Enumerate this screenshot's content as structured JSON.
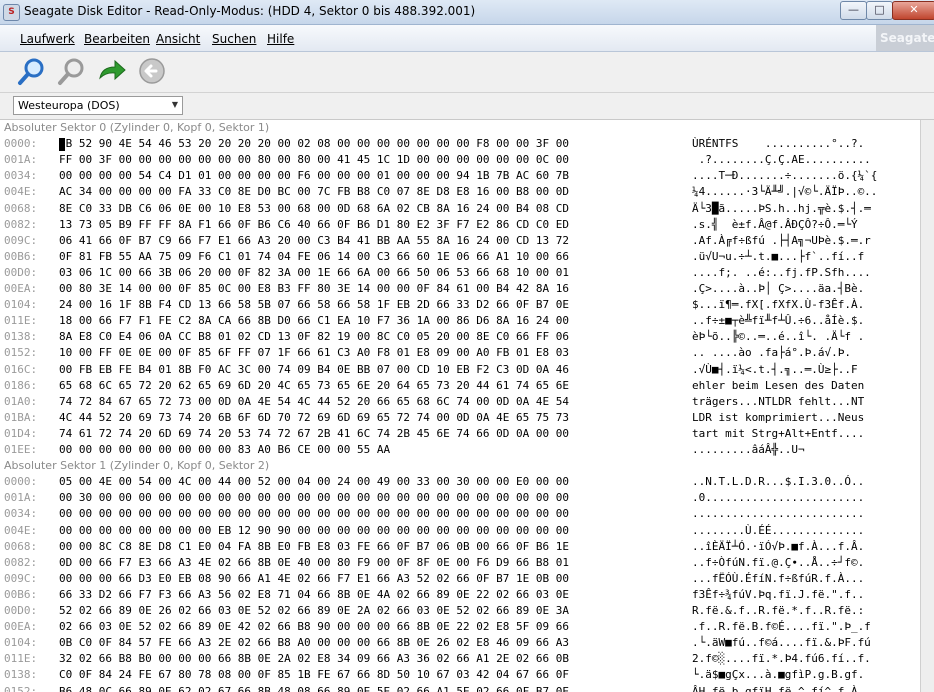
{
  "window": {
    "title": "Seagate Disk Editor - Read-Only-Modus: (HDD 4, Sektor 0 bis 488.392.001)",
    "app_icon_letter": "S",
    "controls": {
      "minimize": "—",
      "maximize": "□",
      "close": "✕"
    }
  },
  "menu": {
    "items": [
      "Laufwerk",
      "Bearbeiten",
      "Ansicht",
      "Suchen",
      "Hilfe"
    ],
    "brand": "Seagate"
  },
  "toolbar": {
    "icons": [
      "search-icon",
      "search-next-icon",
      "forward-arrow-icon",
      "back-arrow-icon"
    ],
    "colors": {
      "forward": "#2e9a2e",
      "back_disabled": "#9a9a9a",
      "magnifier": "#2a6fc4"
    }
  },
  "encoding": {
    "selected": "Westeuropa (DOS)"
  },
  "sectors": [
    {
      "header": "Absoluter Sektor 0 (Zylinder 0, Kopf 0, Sektor 1)",
      "rows": [
        {
          "addr": "0000:",
          "hex": "EB 52 90 4E 54 46 53 20 20 20 20 00 02 08 00 00 00 00 00 00 00 F8 00 00 3F 00",
          "ascii": "ÙRÉNTFS    ..........°..?."
        },
        {
          "addr": "001A:",
          "hex": "FF 00 3F 00 00 00 00 00 00 00 80 00 80 00 41 45 1C 1D 00 00 00 00 00 00 0C 00",
          "ascii": " .?........Ç.Ç.AE.........."
        },
        {
          "addr": "0034:",
          "hex": "00 00 00 00 54 C4 D1 01 00 00 00 00 F6 00 00 00 01 00 00 00 94 1B 7B AC 60 7B",
          "ascii": "....T─Ð.......÷.......ö.{¼`{"
        },
        {
          "addr": "004E:",
          "hex": "AC 34 00 00 00 00 FA 33 C0 8E D0 BC 00 7C FB B8 C0 07 8E D8 E8 16 00 B8 00 0D",
          "ascii": "¼4......·3└Ä╨╝.|√©└.ÄÏÞ..©.."
        },
        {
          "addr": "0068:",
          "hex": "8E C0 33 DB C6 06 0E 00 10 E8 53 00 68 00 0D 68 6A 02 CB 8A 16 24 00 B4 08 CD",
          "ascii": "Ä└3█ã.....ÞS.h..hj.╦è.$.┤.═"
        },
        {
          "addr": "0082:",
          "hex": "13 73 05 B9 FF FF 8A F1 66 0F B6 C6 40 66 0F B6 D1 80 E2 3F F7 E2 86 CD C0 ED",
          "ascii": ".s.╣  è±f.Â@f.ÂÐÇÔ?÷Ô.═└Ý"
        },
        {
          "addr": "009C:",
          "hex": "06 41 66 0F B7 C9 66 F7 E1 66 A3 20 00 C3 B4 41 BB AA 55 8A 16 24 00 CD 13 72",
          "ascii": ".Af.À╔f÷ßfú .├┤A╗¬UÞè.$.═.r"
        },
        {
          "addr": "00B6:",
          "hex": "0F 81 FB 55 AA 75 09 F6 C1 01 74 04 FE 06 14 00 C3 66 60 1E 06 66 A1 10 00 66",
          "ascii": ".ü√U¬u.÷┴.t.■...├f`..fí..f"
        },
        {
          "addr": "00D0:",
          "hex": "03 06 1C 00 66 3B 06 20 00 0F 82 3A 00 1E 66 6A 00 66 50 06 53 66 68 10 00 01",
          "ascii": "....f;. ..é:..fj.fP.Sfh...."
        },
        {
          "addr": "00EA:",
          "hex": "00 80 3E 14 00 00 0F 85 0C 00 E8 B3 FF 80 3E 14 00 00 0F 84 61 00 B4 42 8A 16",
          "ascii": ".Ç>....à..Þ│ Ç>....äa.┤Bè."
        },
        {
          "addr": "0104:",
          "hex": "24 00 16 1F 8B F4 CD 13 66 58 5B 07 66 58 66 58 1F EB 2D 66 33 D2 66 0F B7 0E",
          "ascii": "$...ï¶═.fX[.fXfX.Ù-f3Êf.À."
        },
        {
          "addr": "011E:",
          "hex": "18 00 66 F7 F1 FE C2 8A CA 66 8B D0 66 C1 EA 10 F7 36 1A 00 86 D6 8A 16 24 00",
          "ascii": "..f÷±■┬è╩fï╨f┴Û.÷6..åÍè.$."
        },
        {
          "addr": "0138:",
          "hex": "8A E8 C0 E4 06 0A CC B8 01 02 CD 13 0F 82 19 00 8C C0 05 20 00 8E C0 66 FF 06",
          "ascii": "èÞ└õ..╠©..═..é..î└. .Ä└f ."
        },
        {
          "addr": "0152:",
          "hex": "10 00 FF 0E 0E 00 0F 85 6F FF 07 1F 66 61 C3 A0 F8 01 E8 09 00 A0 FB 01 E8 03",
          "ascii": ".. ....ào .fa├á°.Þ.á√.Þ."
        },
        {
          "addr": "016C:",
          "hex": "00 FB EB FE B4 01 8B F0 AC 3C 00 74 09 B4 0E BB 07 00 CD 10 EB F2 C3 0D 0A 46",
          "ascii": ".√Ù■┤.ï­¼<.t.┤.╗..═.Ù≥├..F"
        },
        {
          "addr": "0186:",
          "hex": "65 68 6C 65 72 20 62 65 69 6D 20 4C 65 73 65 6E 20 64 65 73 20 44 61 74 65 6E",
          "ascii": "ehler beim Lesen des Daten"
        },
        {
          "addr": "01A0:",
          "hex": "74 72 84 67 65 72 73 00 0D 0A 4E 54 4C 44 52 20 66 65 68 6C 74 00 0D 0A 4E 54",
          "ascii": "trägers...NTLDR fehlt...NT"
        },
        {
          "addr": "01BA:",
          "hex": "4C 44 52 20 69 73 74 20 6B 6F 6D 70 72 69 6D 69 65 72 74 00 0D 0A 4E 65 75 73",
          "ascii": "LDR ist komprimiert...Neus"
        },
        {
          "addr": "01D4:",
          "hex": "74 61 72 74 20 6D 69 74 20 53 74 72 67 2B 41 6C 74 2B 45 6E 74 66 0D 0A 00 00",
          "ascii": "tart mit Strg+Alt+Entf...."
        },
        {
          "addr": "01EE:",
          "hex": "00 00 00 00 00 00 00 00 00 83 A0 B6 CE 00 00 55 AA",
          "ascii": ".........âáÂ╬..U¬"
        }
      ]
    },
    {
      "header": "Absoluter Sektor 1 (Zylinder 0, Kopf 0, Sektor 2)",
      "rows": [
        {
          "addr": "0000:",
          "hex": "05 00 4E 00 54 00 4C 00 44 00 52 00 04 00 24 00 49 00 33 00 30 00 00 E0 00 00",
          "ascii": "..N.T.L.D.R...$.I.3.0..Ó.."
        },
        {
          "addr": "001A:",
          "hex": "00 30 00 00 00 00 00 00 00 00 00 00 00 00 00 00 00 00 00 00 00 00 00 00 00 00",
          "ascii": ".0........................"
        },
        {
          "addr": "0034:",
          "hex": "00 00 00 00 00 00 00 00 00 00 00 00 00 00 00 00 00 00 00 00 00 00 00 00 00 00",
          "ascii": ".........................."
        },
        {
          "addr": "004E:",
          "hex": "00 00 00 00 00 00 00 00 EB 12 90 90 00 00 00 00 00 00 00 00 00 00 00 00 00 00",
          "ascii": "........Ù.ÉÉ.............."
        },
        {
          "addr": "0068:",
          "hex": "00 00 8C C8 8E D8 C1 E0 04 FA 8B E0 FB E8 03 FE 66 0F B7 06 0B 00 66 0F B6 1E",
          "ascii": "..îÈÄÏ┴Ó.·ïÓ√Þ.■f.À...f.Â."
        },
        {
          "addr": "0082:",
          "hex": "0D 00 66 F7 E3 66 A3 4E 02 66 8B 0E 40 00 80 F9 00 0F 8F 0E 00 F6 D9 66 B8 01",
          "ascii": "..f÷ÒfúN.fï.@.Ç∙..Å..÷┘f©."
        },
        {
          "addr": "009C:",
          "hex": "00 00 00 66 D3 E0 EB 08 90 66 A1 4E 02 66 F7 E1 66 A3 52 02 66 0F B7 1E 0B 00",
          "ascii": "...fËÓÙ.ÉfíN.f÷ßfúR.f.À..."
        },
        {
          "addr": "00B6:",
          "hex": "66 33 D2 66 F7 F3 66 A3 56 02 E8 71 04 66 8B 0E 4A 02 66 89 0E 22 02 66 03 0E",
          "ascii": "f3Êf÷¾fúV.Þq.fï.J.fë.\".f.."
        },
        {
          "addr": "00D0:",
          "hex": "52 02 66 89 0E 26 02 66 03 0E 52 02 66 89 0E 2A 02 66 03 0E 52 02 66 89 0E 3A",
          "ascii": "R.fë.&.f..R.fë.*.f..R.fë.:"
        },
        {
          "addr": "00EA:",
          "hex": "02 66 03 0E 52 02 66 89 0E 42 02 66 B8 90 00 00 00 66 8B 0E 22 02 E8 5F 09 66",
          "ascii": ".f..R.fë.B.f©É....fï.\".Þ_.f"
        },
        {
          "addr": "0104:",
          "hex": "0B C0 0F 84 57 FE 66 A3 2E 02 66 B8 A0 00 00 00 66 8B 0E 26 02 E8 46 09 66 A3",
          "ascii": ".└.äW■fú..f©á....fï.&.ÞF.fú"
        },
        {
          "addr": "011E:",
          "hex": "32 02 66 B8 B0 00 00 00 66 8B 0E 2A 02 E8 34 09 66 A3 36 02 66 A1 2E 02 66 0B",
          "ascii": "2.f©░....fï.*.Þ4.fú6.fí..f."
        },
        {
          "addr": "0138:",
          "hex": "C0 0F 84 24 FE 67 80 78 08 00 0F 85 1B FE 67 66 8D 50 10 67 03 42 04 67 66 0F",
          "ascii": "└.ä$■gÇx...à.■gfìP.g.B.gf."
        },
        {
          "addr": "0152:",
          "hex": "B6 48 0C 66 89 0E 62 02 67 66 8B 48 08 66 89 0E 5E 02 66 A1 5E 02 66 0F B7 0E",
          "ascii": "ÂH.fë.b.gfïH.fë.^.fí^.f.À."
        }
      ]
    }
  ]
}
